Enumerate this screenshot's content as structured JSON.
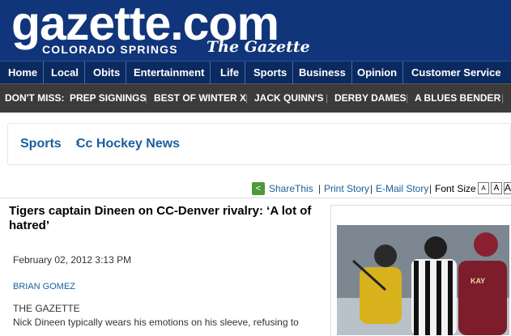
{
  "masthead": {
    "logo": "gazette.com",
    "city": "COLORADO SPRINGS",
    "paper": "The Gazette"
  },
  "nav": [
    "Home",
    "Local",
    "Obits",
    "Entertainment",
    "Life",
    "Sports",
    "Business",
    "Opinion",
    "Customer Service"
  ],
  "dont_miss": {
    "label": "DON'T MISS:",
    "items": [
      "PREP SIGNINGS",
      "BEST OF WINTER X",
      "JACK QUINN'S",
      "DERBY DAMES",
      "A BLUES BENDER"
    ]
  },
  "breadcrumb": {
    "section": "Sports",
    "subsection": "Cc Hockey News"
  },
  "tools": {
    "share": "ShareThis",
    "print": "Print Story",
    "email": "E-Mail Story",
    "font_size": "Font Size",
    "font_btn": "A"
  },
  "article": {
    "headline": "Tigers captain Dineen on CC-Denver rivalry: ‘A lot of hatred’",
    "date": "February 02, 2012 3:13 PM",
    "author": "BRIAN GOMEZ",
    "source": "THE GAZETTE",
    "body": "Nick Dineen typically wears his emotions on his sleeve, refusing to"
  },
  "colors": {
    "masthead": "#11357a",
    "nav": "#0b2a60",
    "dont_miss": "#3b3b3b",
    "link": "#1a5f9c"
  }
}
